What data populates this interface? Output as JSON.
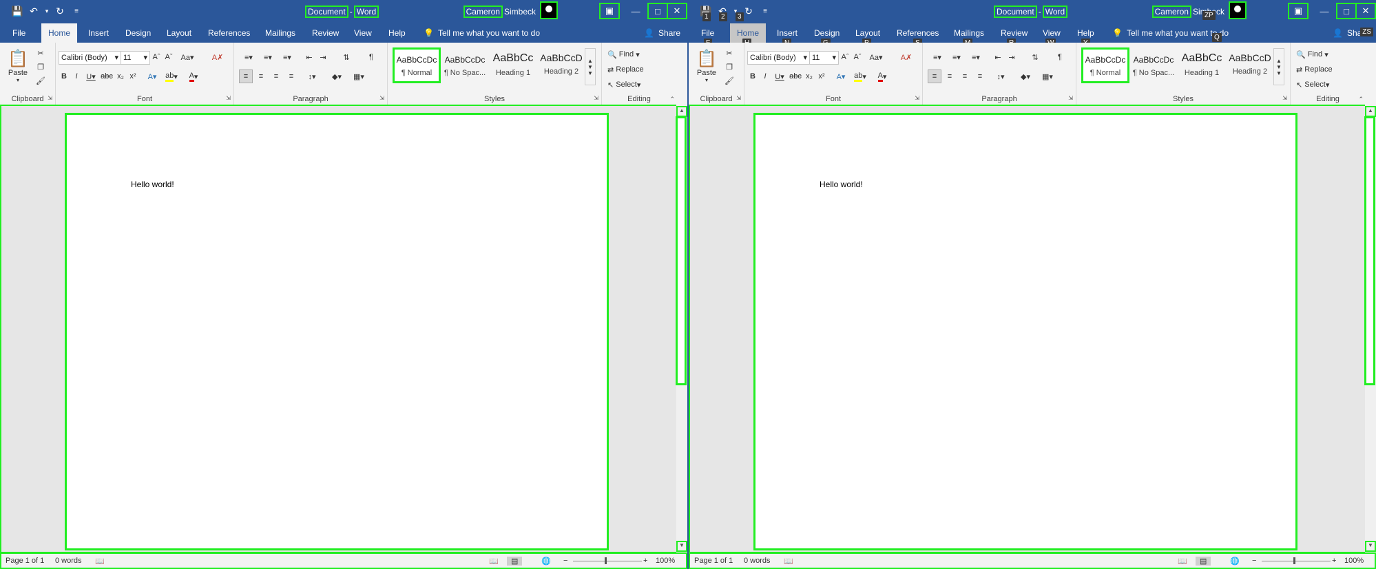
{
  "windows": [
    {
      "id": "left",
      "doc_title": "Document",
      "sep": "-",
      "app_name": "Word",
      "user_first": "Cameron",
      "user_last": "Simbeck",
      "tabs": [
        "File",
        "Home",
        "Insert",
        "Design",
        "Layout",
        "References",
        "Mailings",
        "Review",
        "View",
        "Help"
      ],
      "tell_me": "Tell me what you want to do",
      "share": "Share",
      "font_name": "Calibri (Body)",
      "font_size": "11",
      "styles": [
        {
          "sample": "AaBbCcDc",
          "name": "¶ Normal"
        },
        {
          "sample": "AaBbCcDc",
          "name": "¶ No Spac..."
        },
        {
          "sample": "AaBbCc",
          "name": "Heading 1"
        },
        {
          "sample": "AaBbCcD",
          "name": "Heading 2"
        }
      ],
      "groups": {
        "clipboard": "Clipboard",
        "font": "Font",
        "paragraph": "Paragraph",
        "styles": "Styles",
        "editing": "Editing"
      },
      "paste": "Paste",
      "find": "Find",
      "replace": "Replace",
      "select": "Select",
      "body_text": "Hello world!",
      "status": {
        "page": "Page 1 of 1",
        "words": "0 words",
        "zoom": "100%"
      }
    },
    {
      "id": "right",
      "doc_title": "Document",
      "sep": "-",
      "app_name": "Word",
      "user_first": "Cameron",
      "user_last": "Simbeck",
      "tabs": [
        "File",
        "Home",
        "Insert",
        "Design",
        "Layout",
        "References",
        "Mailings",
        "Review",
        "View",
        "Help"
      ],
      "tell_me": "Tell me what you want to do",
      "share": "Share",
      "font_name": "Calibri (Body)",
      "font_size": "11",
      "styles": [
        {
          "sample": "AaBbCcDc",
          "name": "¶ Normal"
        },
        {
          "sample": "AaBbCcDc",
          "name": "¶ No Spac..."
        },
        {
          "sample": "AaBbCc",
          "name": "Heading 1"
        },
        {
          "sample": "AaBbCcD",
          "name": "Heading 2"
        }
      ],
      "groups": {
        "clipboard": "Clipboard",
        "font": "Font",
        "paragraph": "Paragraph",
        "styles": "Styles",
        "editing": "Editing"
      },
      "paste": "Paste",
      "find": "Find",
      "replace": "Replace",
      "select": "Select",
      "body_text": "Hello world!",
      "status": {
        "page": "Page 1 of 1",
        "words": "0 words",
        "zoom": "100%"
      },
      "keytips": {
        "qat": [
          "1",
          "2",
          "3"
        ],
        "tabs": [
          "F",
          "H",
          "N",
          "G",
          "P",
          "S",
          "M",
          "R",
          "W",
          "Y"
        ],
        "tell": "Q",
        "share": "ZS",
        "user": "ZP"
      }
    }
  ],
  "colors": {
    "brand": "#2b579a",
    "highlight": "#22ee22",
    "heading": "#2e74b5"
  }
}
